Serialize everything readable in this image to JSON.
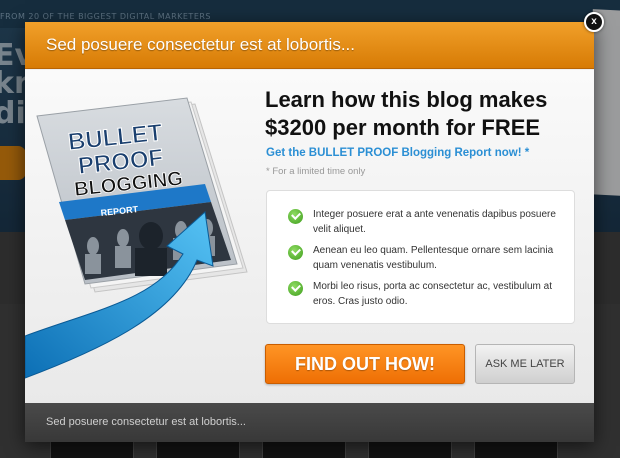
{
  "background": {
    "tagline": "FROM 20 OF THE BIGGEST DIGITAL MARKETERS",
    "hero_lines": [
      "Eve",
      "kno",
      "dig"
    ]
  },
  "popup": {
    "header_title": "Sed posuere consectetur est at lobortis...",
    "close_label": "x",
    "headline": "Learn how this blog makes $3200 per month for FREE",
    "subheadline": "Get the BULLET PROOF Blogging Report now! *",
    "note": "* For a limited time only",
    "product": {
      "line1": "BULLET",
      "line2": "PROOF",
      "line3": "BLOGGING",
      "line4": "REPORT"
    },
    "features": [
      "Integer posuere erat a ante venenatis dapibus posuere velit aliquet.",
      "Aenean eu leo quam. Pellentesque ornare sem lacinia quam venenatis vestibulum.",
      "Morbi leo risus, porta ac consectetur ac, vestibulum at eros. Cras justo odio."
    ],
    "cta_label": "FIND OUT HOW!",
    "secondary_label": "ASK ME LATER",
    "footer_text": "Sed posuere consectetur est at lobortis..."
  },
  "colors": {
    "header_orange": "#e58a10",
    "cta_orange": "#f47c0f",
    "link_blue": "#2b8fd4",
    "check_green": "#5bbf2e"
  }
}
